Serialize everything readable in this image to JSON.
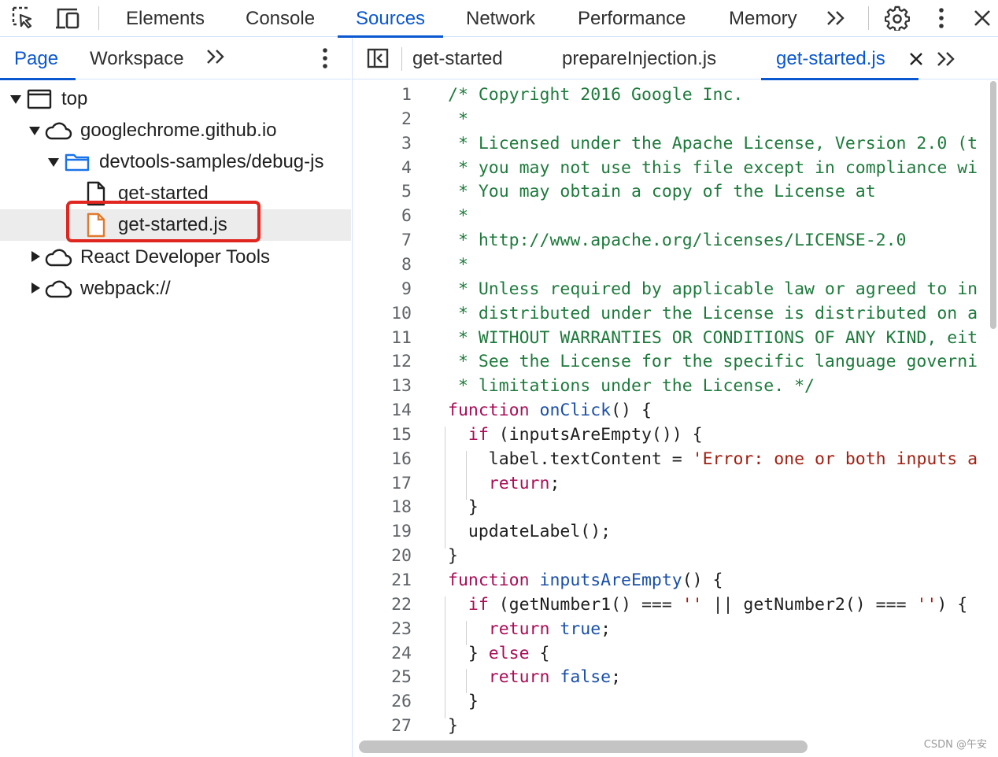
{
  "toolbar": {
    "tabs": [
      {
        "label": "Elements"
      },
      {
        "label": "Console"
      },
      {
        "label": "Sources",
        "active": true
      },
      {
        "label": "Network"
      },
      {
        "label": "Performance"
      },
      {
        "label": "Memory"
      }
    ],
    "icons": [
      "inspect-element-icon",
      "device-toolbar-icon",
      "more-tabs-icon",
      "settings-gear-icon",
      "kebab-menu-icon",
      "close-icon"
    ]
  },
  "navigator": {
    "tabs": [
      {
        "label": "Page",
        "active": true
      },
      {
        "label": "Workspace"
      }
    ],
    "tree": [
      {
        "label": "top",
        "type": "frame",
        "expanded": true
      },
      {
        "label": "googlechrome.github.io",
        "type": "domain",
        "expanded": true
      },
      {
        "label": "devtools-samples/debug-js",
        "type": "folder",
        "expanded": true
      },
      {
        "label": "get-started",
        "type": "document"
      },
      {
        "label": "get-started.js",
        "type": "script",
        "selected": true
      },
      {
        "label": "React Developer Tools",
        "type": "domain",
        "expanded": false
      },
      {
        "label": "webpack://",
        "type": "domain",
        "expanded": false
      }
    ]
  },
  "editor": {
    "tabs": [
      {
        "label": "get-started"
      },
      {
        "label": "prepareInjection.js"
      },
      {
        "label": "get-started.js",
        "active": true,
        "closable": true
      }
    ],
    "lines": [
      {
        "n": "1",
        "t": [
          [
            "c",
            "/* Copyright 2016 Google Inc."
          ]
        ]
      },
      {
        "n": "2",
        "t": [
          [
            "c",
            " *"
          ]
        ]
      },
      {
        "n": "3",
        "t": [
          [
            "c",
            " * Licensed under the Apache License, Version 2.0 (t"
          ]
        ]
      },
      {
        "n": "4",
        "t": [
          [
            "c",
            " * you may not use this file except in compliance wi"
          ]
        ]
      },
      {
        "n": "5",
        "t": [
          [
            "c",
            " * You may obtain a copy of the License at"
          ]
        ]
      },
      {
        "n": "6",
        "t": [
          [
            "c",
            " *"
          ]
        ]
      },
      {
        "n": "7",
        "t": [
          [
            "c",
            " * http://www.apache.org/licenses/LICENSE-2.0"
          ]
        ]
      },
      {
        "n": "8",
        "t": [
          [
            "c",
            " *"
          ]
        ]
      },
      {
        "n": "9",
        "t": [
          [
            "c",
            " * Unless required by applicable law or agreed to in"
          ]
        ]
      },
      {
        "n": "10",
        "t": [
          [
            "c",
            " * distributed under the License is distributed on a"
          ]
        ]
      },
      {
        "n": "11",
        "t": [
          [
            "c",
            " * WITHOUT WARRANTIES OR CONDITIONS OF ANY KIND, eit"
          ]
        ]
      },
      {
        "n": "12",
        "t": [
          [
            "c",
            " * See the License for the specific language governi"
          ]
        ]
      },
      {
        "n": "13",
        "t": [
          [
            "c",
            " * limitations under the License. */"
          ]
        ]
      },
      {
        "n": "14",
        "t": [
          [
            "k",
            "function "
          ],
          [
            "f",
            "onClick"
          ],
          [
            "p",
            "() {"
          ]
        ]
      },
      {
        "n": "15",
        "t": [
          [
            "p",
            "  "
          ],
          [
            "k",
            "if"
          ],
          [
            "p",
            " (inputsAreEmpty()) {"
          ]
        ]
      },
      {
        "n": "16",
        "t": [
          [
            "p",
            "    label.textContent = "
          ],
          [
            "s",
            "'Error: one or both inputs a"
          ]
        ]
      },
      {
        "n": "17",
        "t": [
          [
            "p",
            "    "
          ],
          [
            "k",
            "return"
          ],
          [
            "p",
            ";"
          ]
        ]
      },
      {
        "n": "18",
        "t": [
          [
            "p",
            "  }"
          ]
        ]
      },
      {
        "n": "19",
        "t": [
          [
            "p",
            "  updateLabel();"
          ]
        ]
      },
      {
        "n": "20",
        "t": [
          [
            "p",
            "}"
          ]
        ]
      },
      {
        "n": "21",
        "t": [
          [
            "k",
            "function "
          ],
          [
            "f",
            "inputsAreEmpty"
          ],
          [
            "p",
            "() {"
          ]
        ]
      },
      {
        "n": "22",
        "t": [
          [
            "p",
            "  "
          ],
          [
            "k",
            "if"
          ],
          [
            "p",
            " (getNumber1() === "
          ],
          [
            "s",
            "''"
          ],
          [
            "p",
            " || getNumber2() === "
          ],
          [
            "s",
            "''"
          ],
          [
            "p",
            ") {"
          ]
        ]
      },
      {
        "n": "23",
        "t": [
          [
            "p",
            "    "
          ],
          [
            "k",
            "return "
          ],
          [
            "f",
            "true"
          ],
          [
            "p",
            ";"
          ]
        ]
      },
      {
        "n": "24",
        "t": [
          [
            "p",
            "  } "
          ],
          [
            "k",
            "else"
          ],
          [
            "p",
            " {"
          ]
        ]
      },
      {
        "n": "25",
        "t": [
          [
            "p",
            "    "
          ],
          [
            "k",
            "return "
          ],
          [
            "f",
            "false"
          ],
          [
            "p",
            ";"
          ]
        ]
      },
      {
        "n": "26",
        "t": [
          [
            "p",
            "  }"
          ]
        ]
      },
      {
        "n": "27",
        "t": [
          [
            "p",
            "}"
          ]
        ]
      }
    ]
  },
  "watermark": "CSDN @午安"
}
